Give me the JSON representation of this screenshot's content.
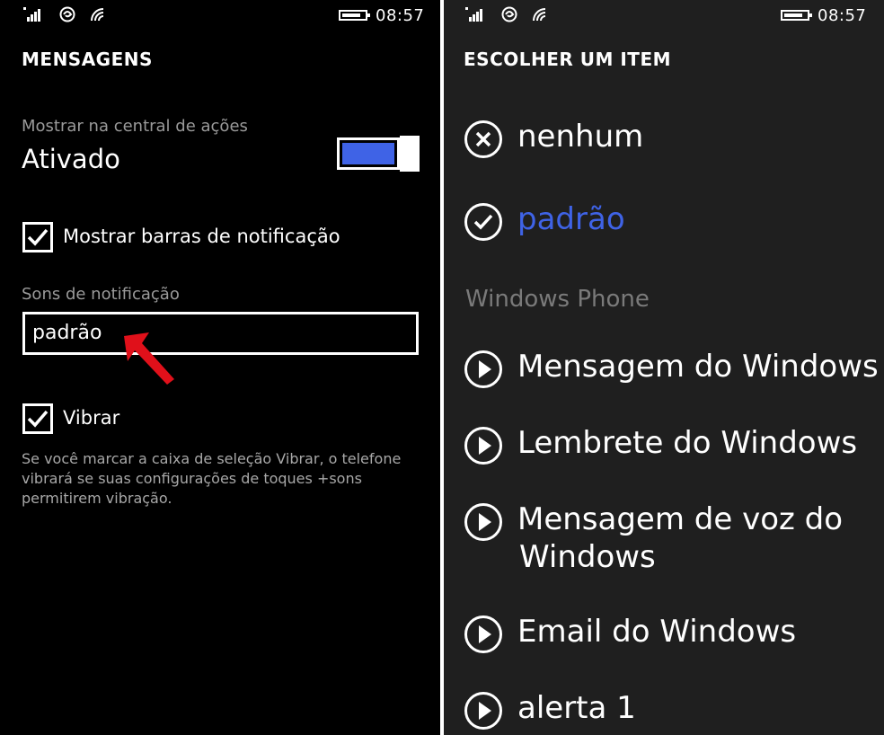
{
  "left": {
    "status": {
      "time": "08:57"
    },
    "title": "MENSAGENS",
    "action_center": {
      "label": "Mostrar na central de ações",
      "value": "Ativado",
      "toggle_on": true
    },
    "show_banners": {
      "label": "Mostrar barras de notificação",
      "checked": true
    },
    "sounds": {
      "label": "Sons de notificação",
      "value": "padrão"
    },
    "vibrate": {
      "label": "Vibrar",
      "checked": true
    },
    "help_text": "Se você marcar a caixa de seleção Vibrar, o telefone vibrará se suas configurações de toques +sons permitirem vibração."
  },
  "right": {
    "status": {
      "time": "08:57"
    },
    "title": "ESCOLHER UM ITEM",
    "options": [
      {
        "label": "nenhum",
        "icon": "none-icon"
      },
      {
        "label": "padrão",
        "icon": "check-icon",
        "selected": true
      }
    ],
    "group_header": "Windows Phone",
    "sounds": [
      {
        "label": "Mensagem do Windows",
        "icon": "play-icon"
      },
      {
        "label": "Lembrete do Windows",
        "icon": "play-icon"
      },
      {
        "label_line1": "Mensagem de voz do",
        "label_line2": "Windows",
        "icon": "play-icon"
      },
      {
        "label": "Email do Windows",
        "icon": "play-icon"
      },
      {
        "label": "alerta 1",
        "icon": "play-icon"
      }
    ]
  },
  "colors": {
    "accent": "#3f63e6",
    "left_bg": "#000000",
    "right_bg": "#1f1f1f",
    "subtle_text": "#9a9a9a",
    "annotation_arrow": "#e0101a"
  }
}
